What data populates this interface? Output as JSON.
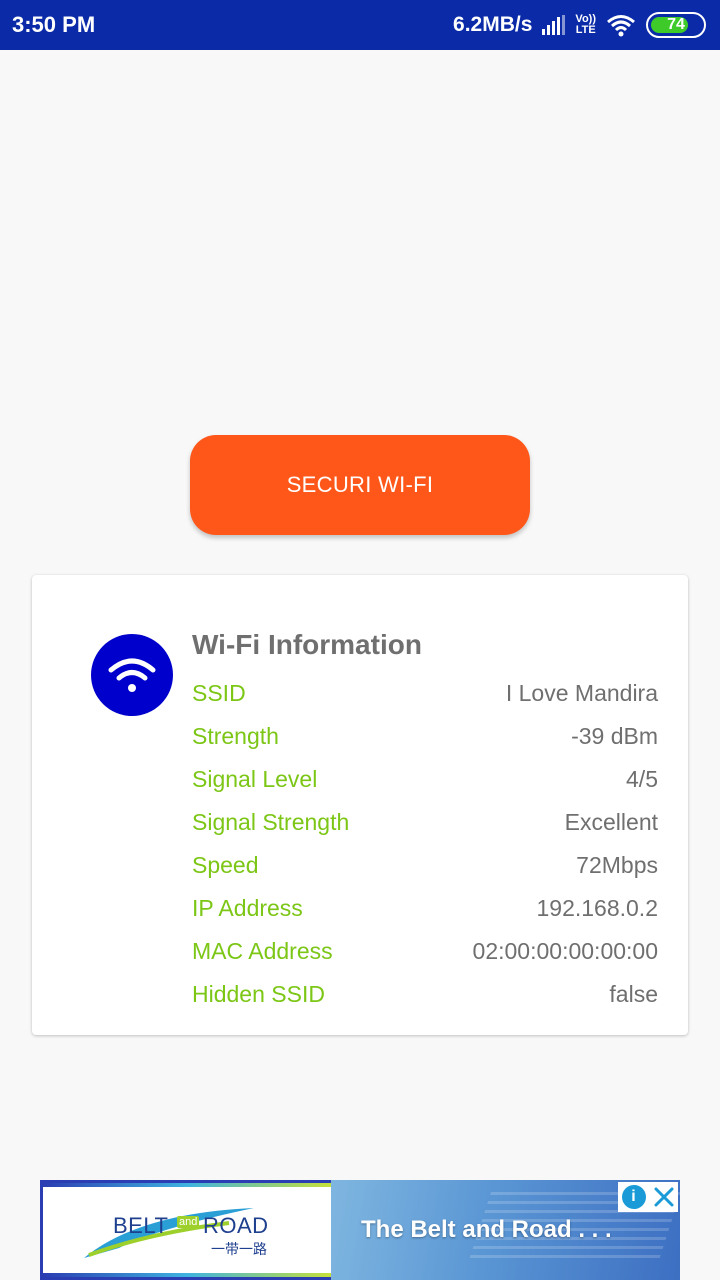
{
  "status_bar": {
    "time": "3:50 PM",
    "net_speed": "6.2MB/s",
    "volte_top": "Vo))",
    "volte_bottom": "LTE",
    "battery": "74",
    "battery_fraction": 0.74,
    "colors": {
      "background": "#0a2aa8",
      "battery": "#3ecb2a"
    }
  },
  "main": {
    "button_label": "SECURI WI-FI",
    "button_color": "#ff5719"
  },
  "wifi_card": {
    "title": "Wi-Fi Information",
    "icon": "wifi-icon",
    "icon_color": "#0000cc",
    "label_color": "#7cc616",
    "rows": [
      {
        "label": "SSID",
        "value": "I Love Mandira"
      },
      {
        "label": "Strength",
        "value": "-39 dBm"
      },
      {
        "label": "Signal Level",
        "value": "4/5"
      },
      {
        "label": "Signal Strength",
        "value": "Excellent"
      },
      {
        "label": "Speed",
        "value": "72Mbps"
      },
      {
        "label": "IP Address",
        "value": "192.168.0.2"
      },
      {
        "label": "MAC Address",
        "value": "02:00:00:00:00:00"
      },
      {
        "label": "Hidden SSID",
        "value": "false"
      }
    ]
  },
  "ad": {
    "logo_text_left": "BELT",
    "logo_text_and": "and",
    "logo_text_right": "ROAD",
    "logo_sub": "一带一路",
    "headline": "The Belt and Road . . ."
  }
}
